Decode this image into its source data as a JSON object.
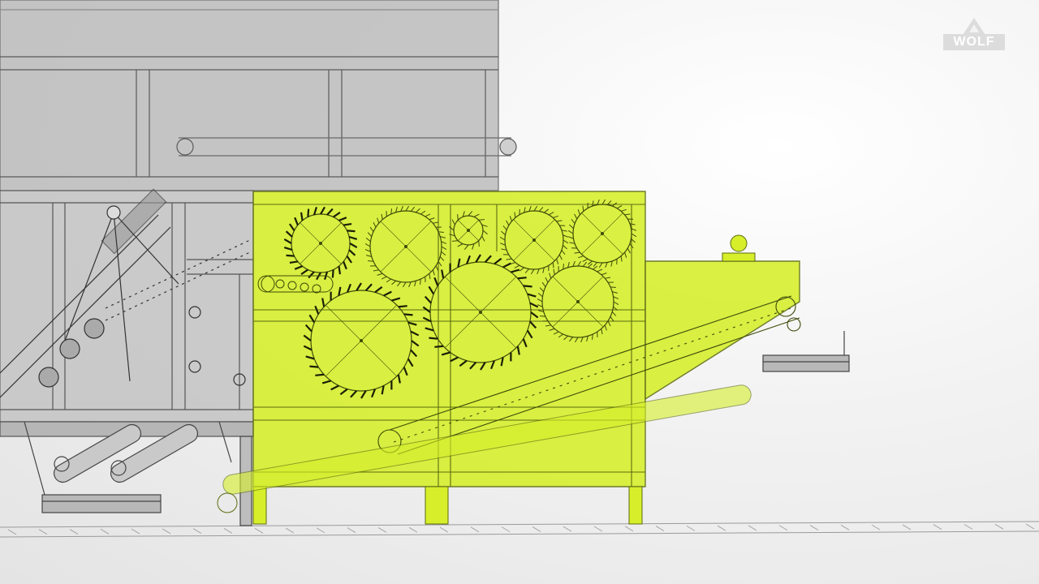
{
  "brand": {
    "logo_text": "WOLF",
    "logo_icon": "mountain-peak-icon"
  },
  "colors": {
    "highlight": "#d6ef2a",
    "highlight_stroke": "#5c6b10",
    "frame_fill": "#bcbcbc",
    "line": "#3a3a3a",
    "background": "#ececec"
  }
}
